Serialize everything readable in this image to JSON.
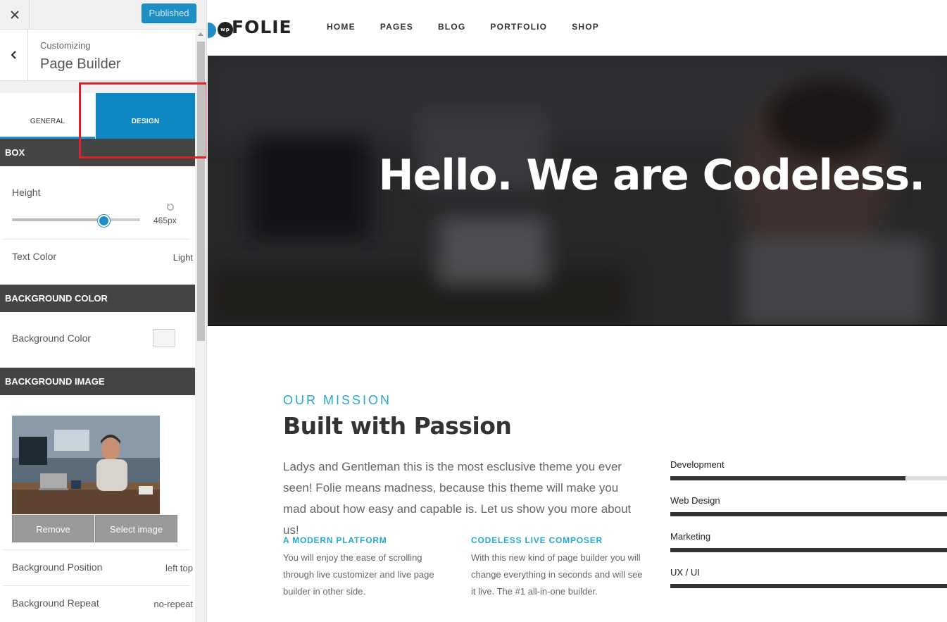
{
  "customizer": {
    "close_icon": "close-icon",
    "publish_label": "Published",
    "breadcrumb": "Customizing",
    "title": "Page Builder",
    "tabs": [
      {
        "label": "GENERAL",
        "active": false
      },
      {
        "label": "DESIGN",
        "active": true
      }
    ],
    "box": {
      "heading": "BOX",
      "height_label": "Height",
      "height_value": "465px",
      "height_fraction": 0.7,
      "text_color_label": "Text Color",
      "text_color_value": "Light"
    },
    "background_color": {
      "heading": "BACKGROUND COLOR",
      "label": "Background Color",
      "swatch_color": "#f5f5f5"
    },
    "background_image": {
      "heading": "BACKGROUND IMAGE",
      "remove_label": "Remove",
      "select_label": "Select image",
      "position_label": "Background Position",
      "position_value": "left top",
      "repeat_label": "Background Repeat",
      "repeat_value": "no-repeat"
    },
    "accent_color": "#1e8fc5",
    "highlight_color": "#e0202a"
  },
  "site": {
    "logo_text": "FOLIE",
    "logo_badge": "wp",
    "nav": [
      "HOME",
      "PAGES",
      "BLOG",
      "PORTFOLIO",
      "SHOP"
    ],
    "hero_title": "Hello. We are Codeless.",
    "mission": {
      "kicker": "OUR MISSION",
      "title": "Built with Passion",
      "body": "Ladys and Gentleman this is the most esclusive theme you ever seen! Folie means madness, because this theme will make you mad about how easy and capable is. Let us show you more about us!",
      "features": [
        {
          "title": "A MODERN PLATFORM",
          "body": "You will enjoy the ease of scrolling through live customizer and live page builder in other side."
        },
        {
          "title": "CODELESS LIVE COMPOSER",
          "body": "With this new kind of page builder you will change everything in seconds and will see it live. The #1 all-in-one builder."
        }
      ]
    },
    "skills": [
      {
        "label": "Development",
        "level": 0.85
      },
      {
        "label": "Web Design",
        "level": 1.0
      },
      {
        "label": "Marketing",
        "level": 1.0
      },
      {
        "label": "UX / UI",
        "level": 1.0
      }
    ],
    "accent_color": "#27a9c9"
  }
}
